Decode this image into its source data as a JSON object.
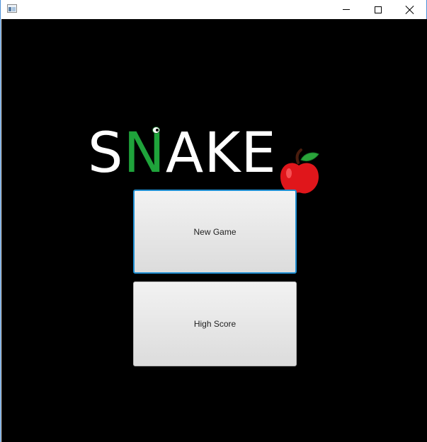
{
  "window": {
    "title": "",
    "controls": [
      "minimize",
      "maximize",
      "close"
    ]
  },
  "logo": {
    "letters": [
      "S",
      "N",
      "A",
      "K",
      "E"
    ],
    "colors": {
      "letters": "#ffffff",
      "n_letter": "#1fa33b",
      "apple": "#e0161b",
      "leaf": "#2aa53a"
    }
  },
  "menu": {
    "new_game_label": "New Game",
    "high_score_label": "High Score",
    "focused": "new_game"
  },
  "colors": {
    "background": "#000000",
    "focus_ring": "#1f8fd3"
  }
}
